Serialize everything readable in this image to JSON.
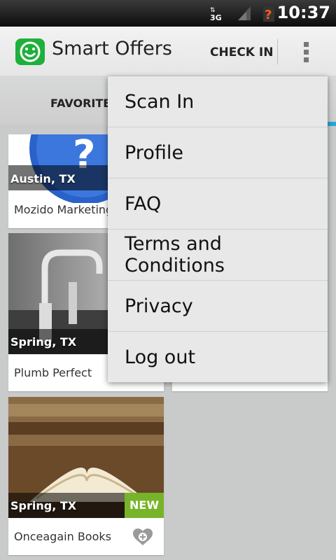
{
  "statusbar": {
    "time": "10:37",
    "network": "3G"
  },
  "actionbar": {
    "title": "Smart Offers",
    "check_in": "CHECK IN"
  },
  "tabs": {
    "favorites": "FAVORITE"
  },
  "cards": [
    {
      "location": "Austin, TX",
      "name": "Mozido Marketing"
    },
    {
      "location": "Spring, TX",
      "name": "Plumb Perfect"
    },
    {
      "location": "Spring, TX",
      "name": "Onceagain Books",
      "badge": "NEW"
    }
  ],
  "menu": {
    "items": [
      "Scan In",
      "Profile",
      "FAQ",
      "Terms and Conditions",
      "Privacy",
      "Log out"
    ]
  },
  "colors": {
    "accent": "#2aa7d8",
    "brand": "#1fb03c",
    "badge": "#78b42a"
  }
}
